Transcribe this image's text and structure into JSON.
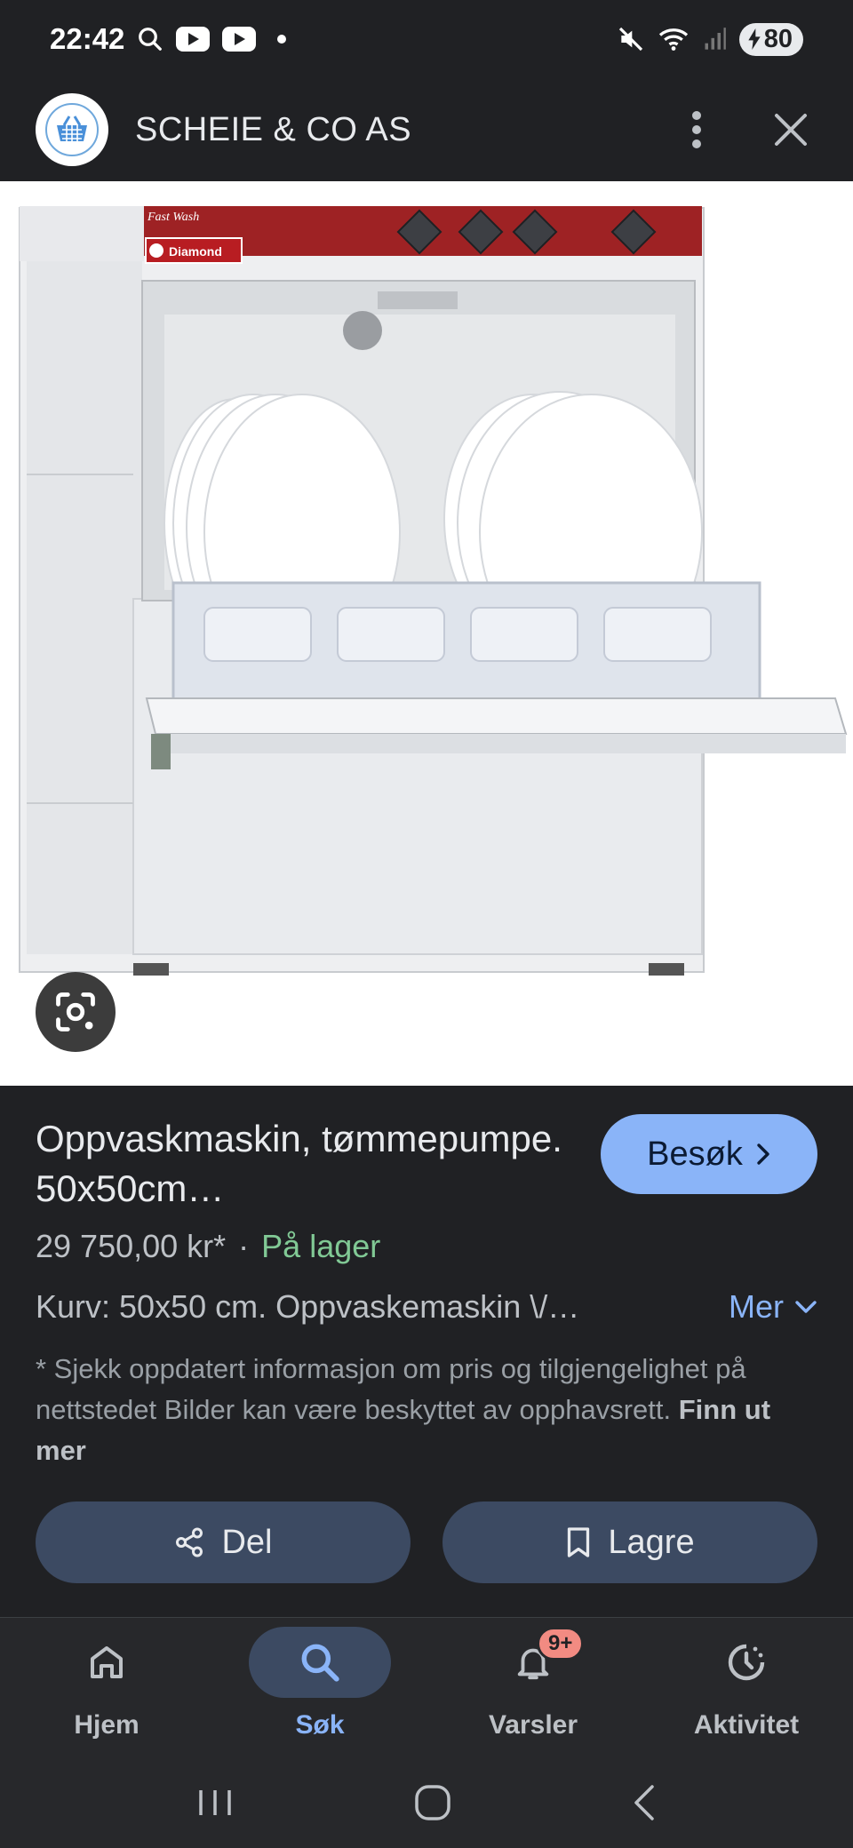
{
  "status_bar": {
    "time": "22:42",
    "battery": "80",
    "icons": [
      "search-icon",
      "youtube-icon",
      "youtube-icon",
      "dot-icon",
      "mute-icon",
      "wifi-icon",
      "signal-icon",
      "battery-charging-icon"
    ]
  },
  "header": {
    "site_name": "SCHEIE & CO AS",
    "logo_icon": "basket-icon",
    "menu_icon": "more-vert-icon",
    "close_icon": "close-icon"
  },
  "image": {
    "alt_subject": "dishwasher",
    "brand_label": "Diamond",
    "model_label": "Fast Wash",
    "lens_icon": "google-lens-icon"
  },
  "product": {
    "title": "Oppvaskmaskin, tømmepumpe. 50x50cm…",
    "visit_label": "Besøk",
    "price": "29 750,00 kr*",
    "separator": "·",
    "stock": "På lager",
    "description": "Kurv: 50x50 cm. Oppvaskemaskin \\/…",
    "more_label": "Mer",
    "disclaimer": "* Sjekk oppdatert informasjon om pris og tilgjengelighet på nettstedet Bilder kan være beskyttet av opphavsrett.",
    "learn_more": "Finn ut mer"
  },
  "actions": {
    "share_label": "Del",
    "save_label": "Lagre"
  },
  "bottom_nav": {
    "items": [
      {
        "label": "Hjem",
        "icon": "home-icon"
      },
      {
        "label": "Søk",
        "icon": "search-icon",
        "active": true
      },
      {
        "label": "Varsler",
        "icon": "bell-icon",
        "badge": "9+"
      },
      {
        "label": "Aktivitet",
        "icon": "activity-icon"
      }
    ]
  },
  "colors": {
    "background": "#202124",
    "accent": "#8ab4f8",
    "stock_green": "#81c995",
    "button_bg": "#3c4a62",
    "badge": "#f28b82"
  }
}
